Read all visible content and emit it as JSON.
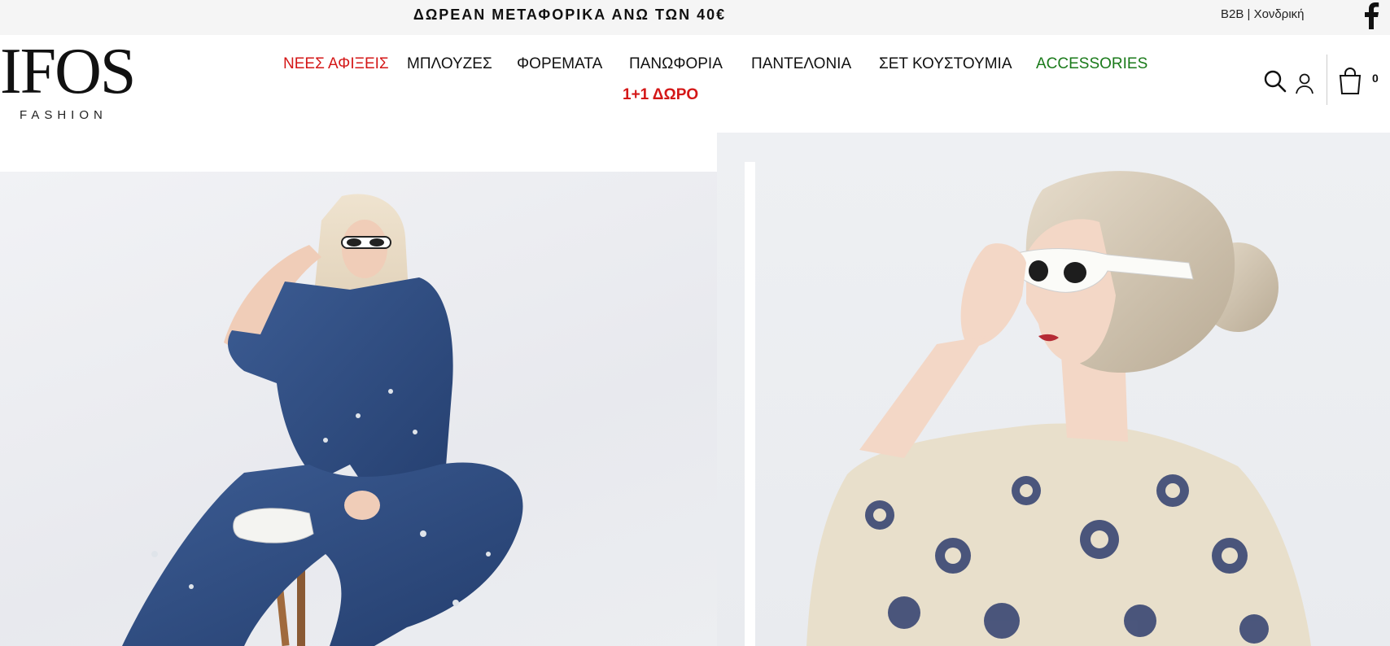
{
  "topbar": {
    "promo": "ΔΩΡΕΑΝ ΜΕΤΑΦΟΡΙΚΑ ΑΝΩ ΤΩΝ 40€",
    "b2b_link": "B2B | Χονδρική",
    "facebook_icon": "facebook-icon"
  },
  "logo": {
    "main": "IFOS",
    "sub": "FASHION"
  },
  "nav": {
    "items": [
      {
        "label": "ΝΕΕΣ ΑΦΙΞΕΙΣ",
        "color": "#d41717"
      },
      {
        "label": "ΜΠΛΟΥΖΕΣ",
        "color": "#111111"
      },
      {
        "label": "ΦΟΡΕΜΑΤΑ",
        "color": "#111111"
      },
      {
        "label": "ΠΑΝΩΦΟΡΙΑ",
        "color": "#111111"
      },
      {
        "label": "ΠΑΝΤΕΛΟΝΙΑ",
        "color": "#111111"
      },
      {
        "label": "ΣΕΤ ΚΟΥΣΤΟΥΜΙΑ",
        "color": "#111111"
      },
      {
        "label": "ACCESSORIES",
        "color": "#1a7a1a"
      },
      {
        "label": "1+1 ΔΩΡΟ",
        "color": "#d41717"
      }
    ]
  },
  "header_icons": {
    "search": "search-icon",
    "account": "user-icon",
    "cart": "shopping-bag-icon",
    "cart_count": "0"
  },
  "hero": {
    "left_image": "model-denim-outfit-sunglasses",
    "right_image": "model-printed-blouse-sunglasses"
  }
}
